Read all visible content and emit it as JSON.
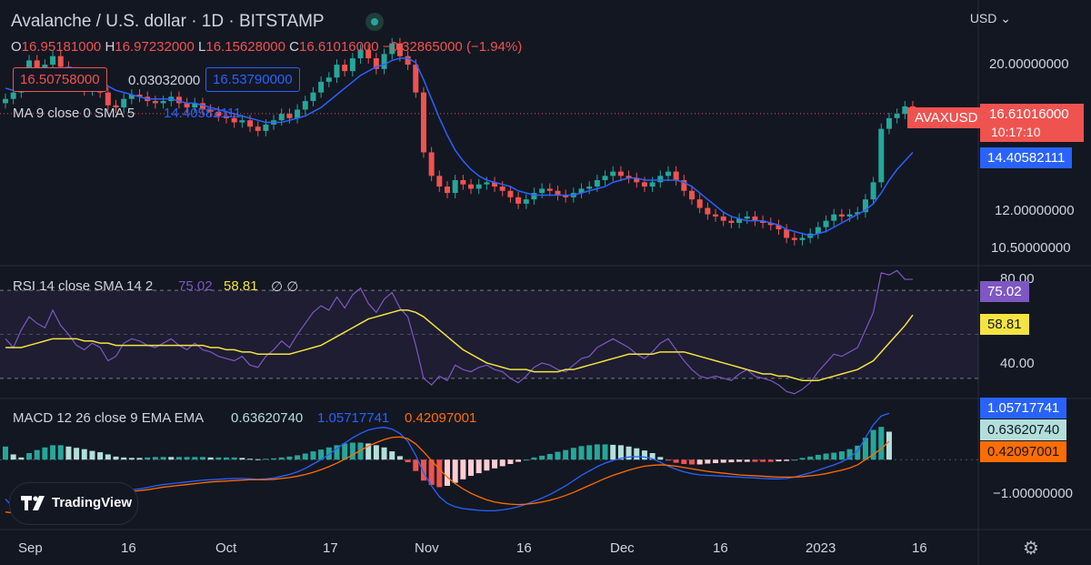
{
  "header": {
    "title": "Avalanche / U.S. dollar · 1D · BITSTAMP",
    "currency": "USD",
    "ohlc": [
      {
        "k": "O",
        "v": "16.95181000"
      },
      {
        "k": "H",
        "v": "16.97232000"
      },
      {
        "k": "L",
        "v": "16.15628000"
      },
      {
        "k": "C",
        "v": "16.61016000"
      },
      {
        "k": "",
        "v": "−0.32865000 (−1.94%)"
      }
    ],
    "bid": "16.50758000",
    "spread": "0.03032000",
    "ask": "16.53790000",
    "ma_label": "MA 9 close 0 SMA 5",
    "ma_value": "14.40582111"
  },
  "price_axis": {
    "ticks": [
      "20.00000000",
      "12.00000000",
      "10.50000000"
    ],
    "symbol_tag": "AVAXUSD",
    "last_price": "16.61016000",
    "countdown": "10:17:10",
    "ma_tag": "14.40582111"
  },
  "rsi": {
    "label": "RSI 14 close SMA 14 2",
    "rsi_value": "75.02",
    "sma_value": "58.81",
    "extra": "∅ ∅",
    "ticks": [
      "80.00",
      "40.00"
    ],
    "tag_rsi": "75.02",
    "tag_sma": "58.81"
  },
  "macd": {
    "label": "MACD 12 26 close 9 EMA EMA",
    "hist_value": "0.63620740",
    "macd_value": "1.05717741",
    "signal_value": "0.42097001",
    "ticks": [
      "−1.00000000"
    ],
    "tag_macd": "1.05717741",
    "tag_hist": "0.63620740",
    "tag_signal": "0.42097001"
  },
  "time_axis": [
    "Sep",
    "16",
    "Oct",
    "17",
    "Nov",
    "16",
    "Dec",
    "16",
    "2023",
    "16"
  ],
  "branding": {
    "logo_text": "TradingView"
  },
  "colors": {
    "up": "#26a69a",
    "down": "#ef5350",
    "ma": "#2962ff",
    "rsi": "#7e57c2",
    "rsi_sma": "#f5e342",
    "signal": "#ff6d00",
    "hist_pos": "#26a69a",
    "hist_pos_light": "#b2dfdb",
    "hist_neg": "#ef5350",
    "hist_neg_light": "#ffcdd2"
  },
  "chart_data": {
    "type": "line",
    "title": "Avalanche / U.S. dollar · 1D · BITSTAMP",
    "xlabel": "",
    "ylabel": "",
    "ylim": [
      9.5,
      21.5
    ],
    "x_ticks": [
      "Sep",
      "16",
      "Oct",
      "17",
      "Nov",
      "16",
      "Dec",
      "16",
      "2023",
      "16"
    ],
    "series": [
      {
        "name": "AVAXUSD",
        "values": [
          17.3,
          17.6,
          18.2,
          19.1,
          18.6,
          18.9,
          19.3,
          18.8,
          18.4,
          17.9,
          17.7,
          17.9,
          17.6,
          17.0,
          16.9,
          17.3,
          17.5,
          17.4,
          17.2,
          17.1,
          17.2,
          17.4,
          17.1,
          16.9,
          17.1,
          16.8,
          16.7,
          16.5,
          16.4,
          16.2,
          16.3,
          16.0,
          15.8,
          16.1,
          16.3,
          16.6,
          16.4,
          16.8,
          17.2,
          17.6,
          18.1,
          18.3,
          18.9,
          18.6,
          19.2,
          19.6,
          19.2,
          18.7,
          19.4,
          19.9,
          19.3,
          18.9,
          17.6,
          14.8,
          13.7,
          13.2,
          12.9,
          13.5,
          13.3,
          13.1,
          13.3,
          13.4,
          13.2,
          13.0,
          12.7,
          12.4,
          12.6,
          12.9,
          13.1,
          13.0,
          12.8,
          12.7,
          12.9,
          13.1,
          13.2,
          13.5,
          13.7,
          13.9,
          13.7,
          13.6,
          13.4,
          13.2,
          13.4,
          13.7,
          13.9,
          13.5,
          13.0,
          12.6,
          12.2,
          11.9,
          11.8,
          11.6,
          11.5,
          11.7,
          11.8,
          11.6,
          11.5,
          11.4,
          11.2,
          10.8,
          10.7,
          10.8,
          11.0,
          11.3,
          11.6,
          11.9,
          11.8,
          11.9,
          12.0,
          12.6,
          13.4,
          15.9,
          16.4,
          16.6,
          16.95,
          16.61
        ]
      },
      {
        "name": "MA",
        "values": [
          17.8,
          17.7,
          17.8,
          18.0,
          18.2,
          18.4,
          18.6,
          18.7,
          18.8,
          18.7,
          18.6,
          18.4,
          18.2,
          17.9,
          17.7,
          17.6,
          17.5,
          17.4,
          17.3,
          17.3,
          17.3,
          17.3,
          17.2,
          17.1,
          17.1,
          17.0,
          16.9,
          16.8,
          16.7,
          16.6,
          16.5,
          16.4,
          16.3,
          16.2,
          16.2,
          16.2,
          16.3,
          16.4,
          16.5,
          16.7,
          16.9,
          17.2,
          17.5,
          17.8,
          18.1,
          18.4,
          18.6,
          18.8,
          18.9,
          19.1,
          19.2,
          19.2,
          19.0,
          18.2,
          17.3,
          16.4,
          15.6,
          14.9,
          14.4,
          14.0,
          13.7,
          13.5,
          13.4,
          13.3,
          13.2,
          13.0,
          12.9,
          12.8,
          12.8,
          12.8,
          12.8,
          12.8,
          12.8,
          12.9,
          13.0,
          13.1,
          13.2,
          13.4,
          13.5,
          13.6,
          13.6,
          13.5,
          13.5,
          13.5,
          13.5,
          13.5,
          13.4,
          13.2,
          12.9,
          12.6,
          12.3,
          12.0,
          11.8,
          11.7,
          11.6,
          11.6,
          11.6,
          11.5,
          11.4,
          11.2,
          11.1,
          11.0,
          10.9,
          11.0,
          11.1,
          11.3,
          11.5,
          11.7,
          11.9,
          12.1,
          12.4,
          12.9,
          13.5,
          14.0,
          14.4,
          14.8
        ]
      }
    ],
    "rsi": {
      "ylim": [
        20,
        80
      ],
      "series": [
        {
          "name": "RSI",
          "values": [
            48,
            44,
            52,
            58,
            55,
            53,
            61,
            54,
            50,
            45,
            43,
            46,
            44,
            38,
            40,
            46,
            48,
            47,
            45,
            44,
            46,
            48,
            45,
            43,
            46,
            43,
            42,
            40,
            39,
            38,
            40,
            36,
            35,
            40,
            43,
            47,
            44,
            50,
            55,
            60,
            63,
            61,
            67,
            62,
            68,
            71,
            64,
            60,
            66,
            69,
            62,
            58,
            45,
            30,
            27,
            31,
            29,
            36,
            34,
            33,
            35,
            36,
            34,
            33,
            30,
            28,
            31,
            35,
            37,
            36,
            34,
            33,
            36,
            39,
            40,
            44,
            46,
            48,
            46,
            44,
            41,
            39,
            42,
            46,
            48,
            43,
            38,
            34,
            31,
            30,
            31,
            30,
            29,
            32,
            34,
            31,
            30,
            29,
            27,
            24,
            23,
            25,
            28,
            33,
            37,
            41,
            40,
            42,
            44,
            52,
            60,
            78,
            77,
            79,
            75,
            75
          ]
        },
        {
          "name": "RSI SMA",
          "values": [
            44,
            44,
            44,
            45,
            46,
            47,
            48,
            48,
            48,
            48,
            47,
            47,
            46,
            46,
            45,
            45,
            45,
            45,
            45,
            45,
            45,
            45,
            45,
            45,
            45,
            45,
            44,
            44,
            43,
            43,
            42,
            42,
            41,
            41,
            41,
            41,
            41,
            42,
            43,
            44,
            45,
            47,
            49,
            51,
            53,
            55,
            57,
            58,
            59,
            60,
            61,
            61,
            60,
            58,
            55,
            52,
            49,
            46,
            43,
            41,
            39,
            37,
            36,
            35,
            34,
            34,
            34,
            33,
            33,
            33,
            33,
            34,
            34,
            35,
            36,
            37,
            38,
            39,
            40,
            41,
            41,
            41,
            41,
            42,
            42,
            42,
            42,
            41,
            40,
            39,
            38,
            37,
            36,
            35,
            34,
            33,
            32,
            32,
            31,
            31,
            30,
            29,
            29,
            29,
            30,
            31,
            32,
            33,
            34,
            36,
            38,
            42,
            46,
            50,
            54,
            58.81
          ]
        }
      ]
    },
    "macd": {
      "ylim": [
        -1.6,
        1.4
      ],
      "series": [
        {
          "name": "MACD",
          "values": [
            -0.9,
            -1.1,
            -1.2,
            -1.1,
            -1.0,
            -0.9,
            -0.8,
            -0.75,
            -0.72,
            -0.7,
            -0.68,
            -0.67,
            -0.66,
            -0.68,
            -0.7,
            -0.7,
            -0.69,
            -0.67,
            -0.64,
            -0.6,
            -0.57,
            -0.55,
            -0.53,
            -0.51,
            -0.49,
            -0.47,
            -0.46,
            -0.45,
            -0.44,
            -0.43,
            -0.43,
            -0.44,
            -0.45,
            -0.44,
            -0.42,
            -0.38,
            -0.34,
            -0.28,
            -0.2,
            -0.1,
            0.0,
            0.12,
            0.25,
            0.38,
            0.5,
            0.6,
            0.68,
            0.72,
            0.74,
            0.7,
            0.6,
            0.42,
            0.1,
            -0.3,
            -0.6,
            -0.85,
            -1.0,
            -1.08,
            -1.12,
            -1.14,
            -1.16,
            -1.17,
            -1.17,
            -1.15,
            -1.12,
            -1.08,
            -1.02,
            -0.95,
            -0.88,
            -0.8,
            -0.7,
            -0.6,
            -0.48,
            -0.36,
            -0.26,
            -0.16,
            -0.08,
            -0.02,
            0.03,
            0.06,
            0.07,
            0.06,
            0.02,
            -0.06,
            -0.15,
            -0.22,
            -0.28,
            -0.32,
            -0.35,
            -0.36,
            -0.37,
            -0.38,
            -0.39,
            -0.4,
            -0.41,
            -0.42,
            -0.43,
            -0.44,
            -0.44,
            -0.43,
            -0.4,
            -0.35,
            -0.3,
            -0.24,
            -0.18,
            -0.12,
            -0.05,
            0.05,
            0.2,
            0.5,
            0.8,
            1.0,
            1.06
          ]
        },
        {
          "name": "Signal",
          "values": [
            -1.2,
            -1.22,
            -1.25,
            -1.25,
            -1.22,
            -1.18,
            -1.13,
            -1.08,
            -1.02,
            -0.97,
            -0.92,
            -0.87,
            -0.83,
            -0.8,
            -0.77,
            -0.75,
            -0.73,
            -0.71,
            -0.69,
            -0.66,
            -0.63,
            -0.61,
            -0.59,
            -0.57,
            -0.55,
            -0.53,
            -0.51,
            -0.5,
            -0.49,
            -0.48,
            -0.47,
            -0.46,
            -0.46,
            -0.46,
            -0.45,
            -0.43,
            -0.41,
            -0.38,
            -0.34,
            -0.29,
            -0.23,
            -0.16,
            -0.08,
            0.01,
            0.11,
            0.21,
            0.31,
            0.39,
            0.46,
            0.51,
            0.52,
            0.48,
            0.36,
            0.18,
            -0.02,
            -0.22,
            -0.4,
            -0.55,
            -0.67,
            -0.77,
            -0.85,
            -0.92,
            -0.97,
            -1.0,
            -1.02,
            -1.03,
            -1.02,
            -1.0,
            -0.97,
            -0.93,
            -0.88,
            -0.82,
            -0.75,
            -0.67,
            -0.59,
            -0.51,
            -0.43,
            -0.36,
            -0.3,
            -0.24,
            -0.19,
            -0.15,
            -0.13,
            -0.12,
            -0.13,
            -0.15,
            -0.18,
            -0.21,
            -0.24,
            -0.27,
            -0.29,
            -0.31,
            -0.33,
            -0.35,
            -0.36,
            -0.37,
            -0.38,
            -0.39,
            -0.4,
            -0.4,
            -0.4,
            -0.39,
            -0.37,
            -0.35,
            -0.32,
            -0.28,
            -0.24,
            -0.19,
            -0.12,
            0.0,
            0.12,
            0.25,
            0.42
          ]
        }
      ]
    }
  }
}
